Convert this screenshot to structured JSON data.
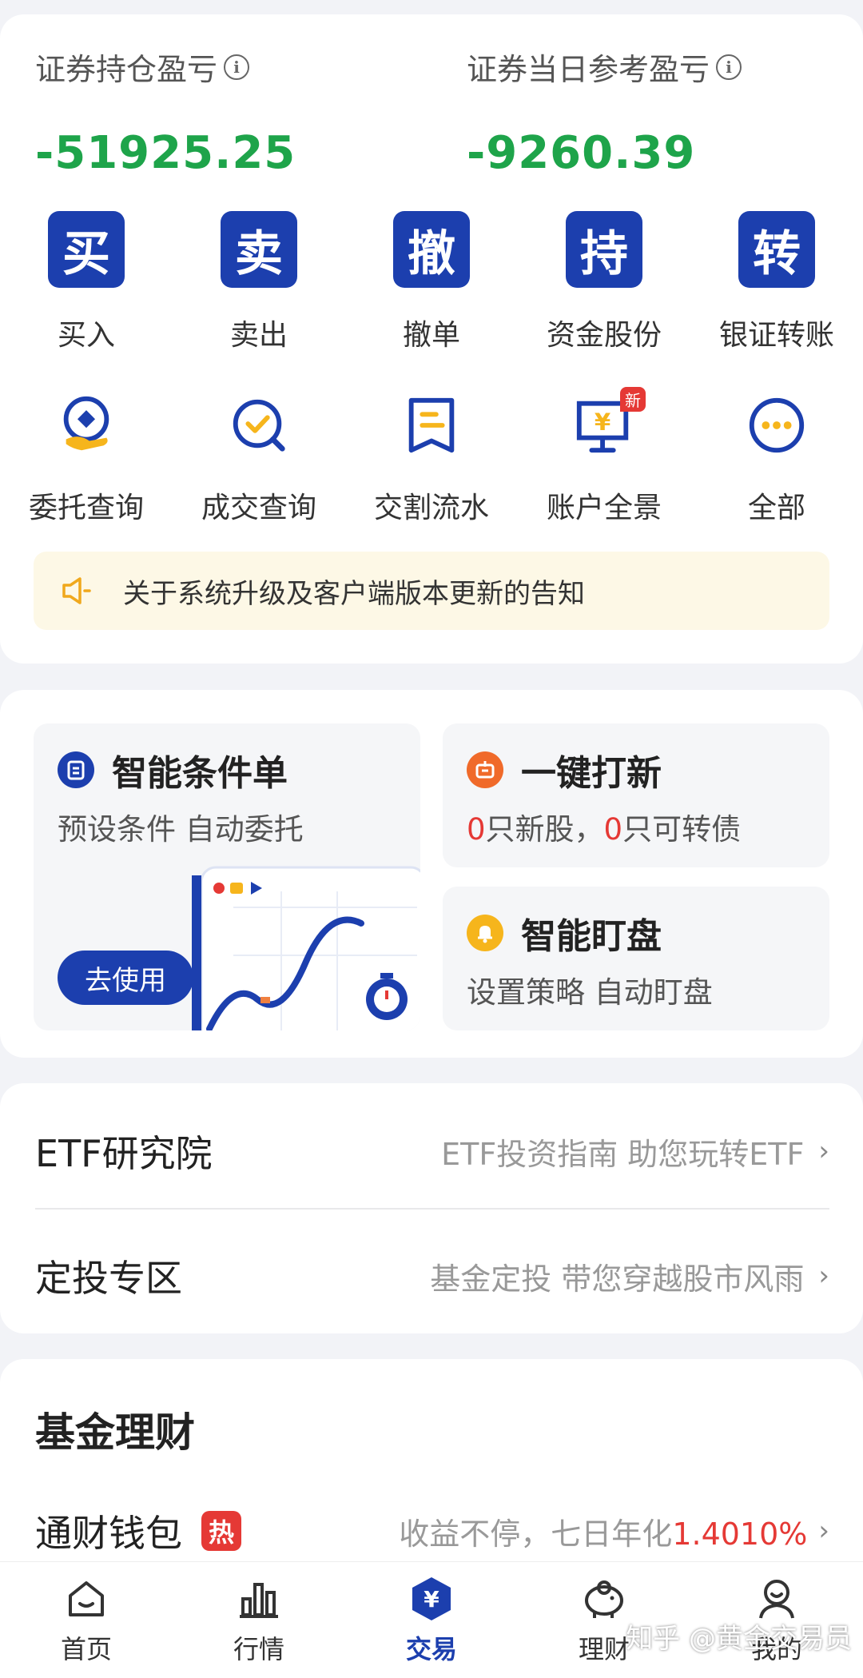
{
  "summary": {
    "holding_pl_label": "证券持仓盈亏",
    "holding_pl_value": "-51925.25",
    "daily_pl_label": "证券当日参考盈亏",
    "daily_pl_value": "-9260.39",
    "value_color": "#1ea44a"
  },
  "quick_actions": [
    {
      "glyph": "买",
      "label": "买入"
    },
    {
      "glyph": "卖",
      "label": "卖出"
    },
    {
      "glyph": "撤",
      "label": "撤单"
    },
    {
      "glyph": "持",
      "label": "资金股份"
    },
    {
      "glyph": "转",
      "label": "银证转账"
    }
  ],
  "secondary_actions": [
    {
      "icon": "entrust-query-icon",
      "label": "委托查询"
    },
    {
      "icon": "deal-query-icon",
      "label": "成交查询"
    },
    {
      "icon": "settlement-flow-icon",
      "label": "交割流水"
    },
    {
      "icon": "account-overview-icon",
      "label": "账户全景",
      "badge": "新"
    },
    {
      "icon": "more-icon",
      "label": "全部"
    }
  ],
  "notice": {
    "text": "关于系统升级及客户端版本更新的告知"
  },
  "features": {
    "smart_order": {
      "title": "智能条件单",
      "subtitle": "预设条件 自动委托",
      "button": "去使用"
    },
    "ipo": {
      "title": "一键打新",
      "count1": "0",
      "text1": "只新股，",
      "count2": "0",
      "text2": "只可转债"
    },
    "watch": {
      "title": "智能盯盘",
      "subtitle": "设置策略 自动盯盘"
    }
  },
  "list": [
    {
      "title": "ETF研究院",
      "desc": "ETF投资指南 助您玩转ETF"
    },
    {
      "title": "定投专区",
      "desc": "基金定投 带您穿越股市风雨"
    }
  ],
  "fund": {
    "section_title": "基金理财",
    "name": "通财钱包",
    "hot": "热",
    "desc": "收益不停，七日年化",
    "rate": "1.4010%"
  },
  "nav": [
    {
      "label": "首页"
    },
    {
      "label": "行情"
    },
    {
      "label": "交易",
      "active": true
    },
    {
      "label": "理财"
    },
    {
      "label": "我的"
    }
  ],
  "watermark": "知乎 @黄金交易员",
  "colors": {
    "primary": "#1c3fae",
    "loss_green": "#1ea44a",
    "highlight_red": "#e53935"
  }
}
